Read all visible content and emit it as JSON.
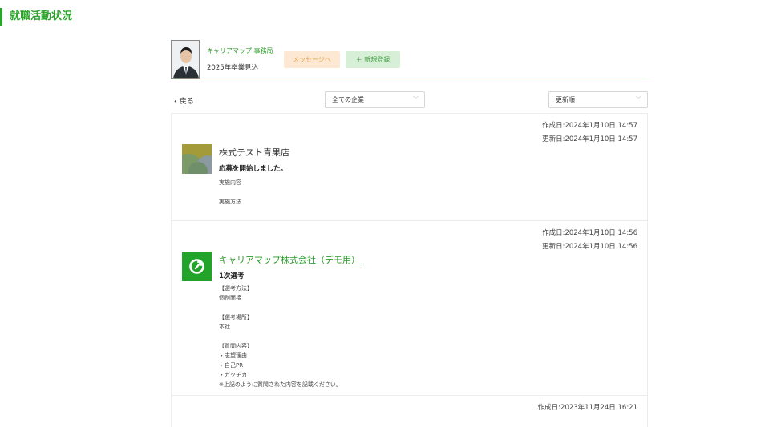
{
  "page": {
    "title": "就職活動状況"
  },
  "profile": {
    "owner": "キャリアマップ 事務局",
    "graduation": "2025年卒業見込",
    "message_button": "メッセージへ",
    "new_button": "新規登録"
  },
  "controls": {
    "back": "戻る",
    "company_filter": "全ての企業",
    "sort": "更新順"
  },
  "entries": [
    {
      "created": "作成日:2024年1月10日 14:57",
      "updated": "更新日:2024年1月10日 14:57",
      "company": "株式テスト青果店",
      "status": "応募を開始しました。",
      "detail1": "実施内容",
      "detail2": "実施方法"
    },
    {
      "created": "作成日:2024年1月10日 14:56",
      "updated": "更新日:2024年1月10日 14:56",
      "company": "キャリアマップ株式会社（デモ用）",
      "status": "1次選考",
      "detail": "【選考方法】\n個別面接\n\n【選考場所】\n本社\n\n【質問内容】\n・志望理由\n・自己PR\n・ガクチカ\n※上記のように質問された内容を記載ください。"
    },
    {
      "created": "作成日:2023年11月24日 16:21"
    }
  ],
  "colors": {
    "accent": "#2aa52a",
    "message_bg": "#fde8d3",
    "new_bg": "#d7efd7"
  }
}
